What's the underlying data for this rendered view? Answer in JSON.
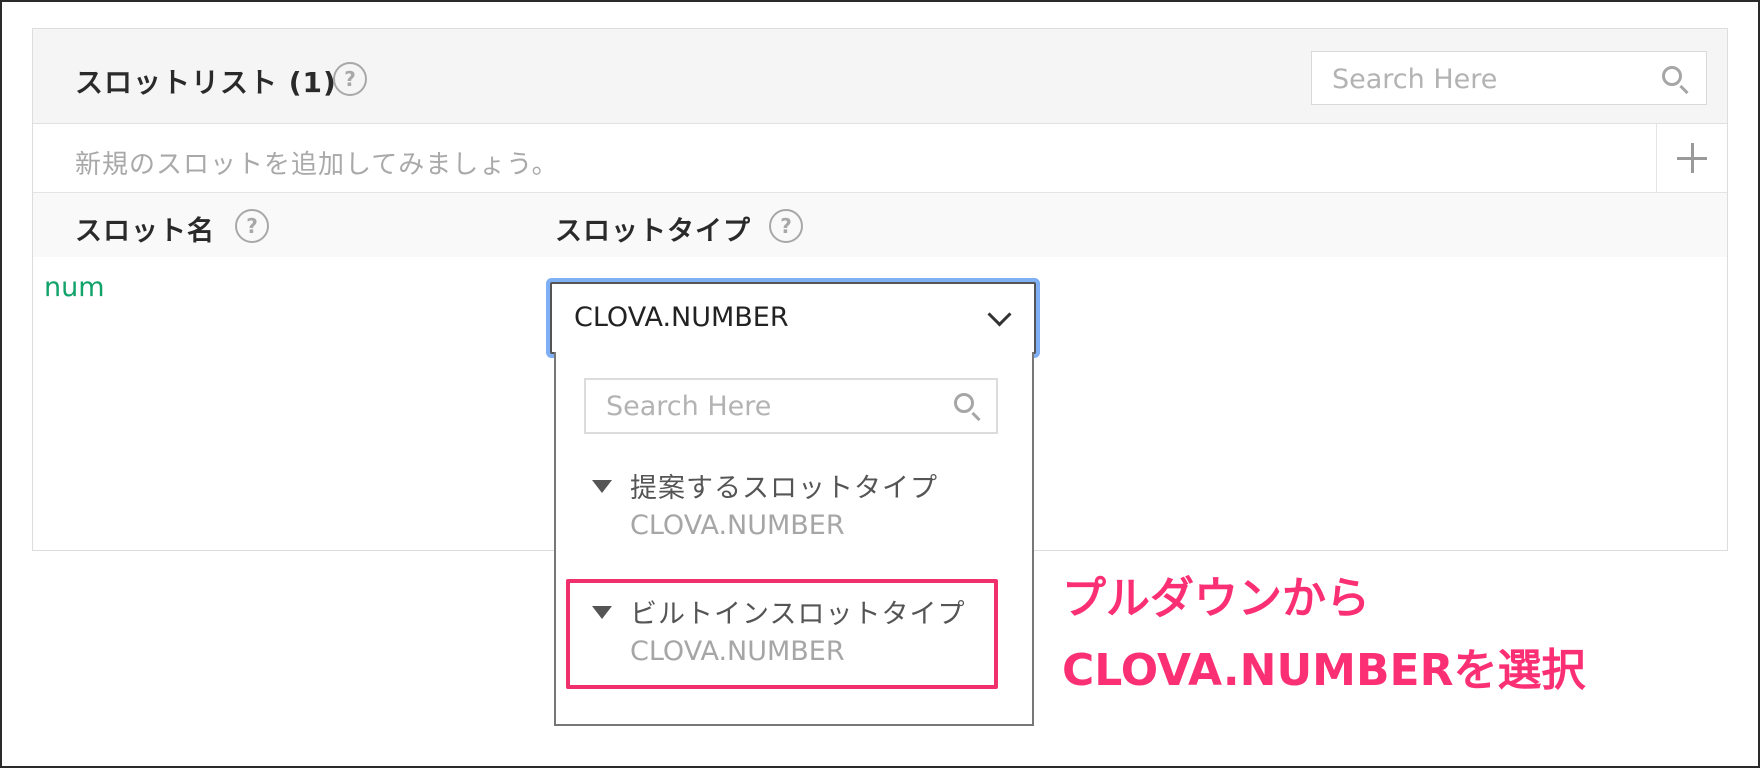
{
  "panel": {
    "title": "スロットリスト (1)",
    "search_placeholder": "Search Here",
    "add_placeholder": "新規のスロットを追加してみましょう。",
    "columns": [
      "スロット名",
      "スロットタイプ"
    ]
  },
  "slots": [
    {
      "name": "num",
      "type": "CLOVA.NUMBER"
    }
  ],
  "dropdown": {
    "search_placeholder": "Search Here",
    "groups": [
      {
        "title": "提案するスロットタイプ",
        "items": [
          "CLOVA.NUMBER"
        ]
      },
      {
        "title": "ビルトインスロットタイプ",
        "items": [
          "CLOVA.NUMBER"
        ]
      }
    ]
  },
  "annotation": {
    "line1": "プルダウンから",
    "line2": "CLOVA.NUMBERを選択",
    "color": "#fb2f74"
  },
  "colors": {
    "slot_name": "#12a36a",
    "focus_ring": "#7fb0f5",
    "highlight_border": "#f0306d"
  }
}
